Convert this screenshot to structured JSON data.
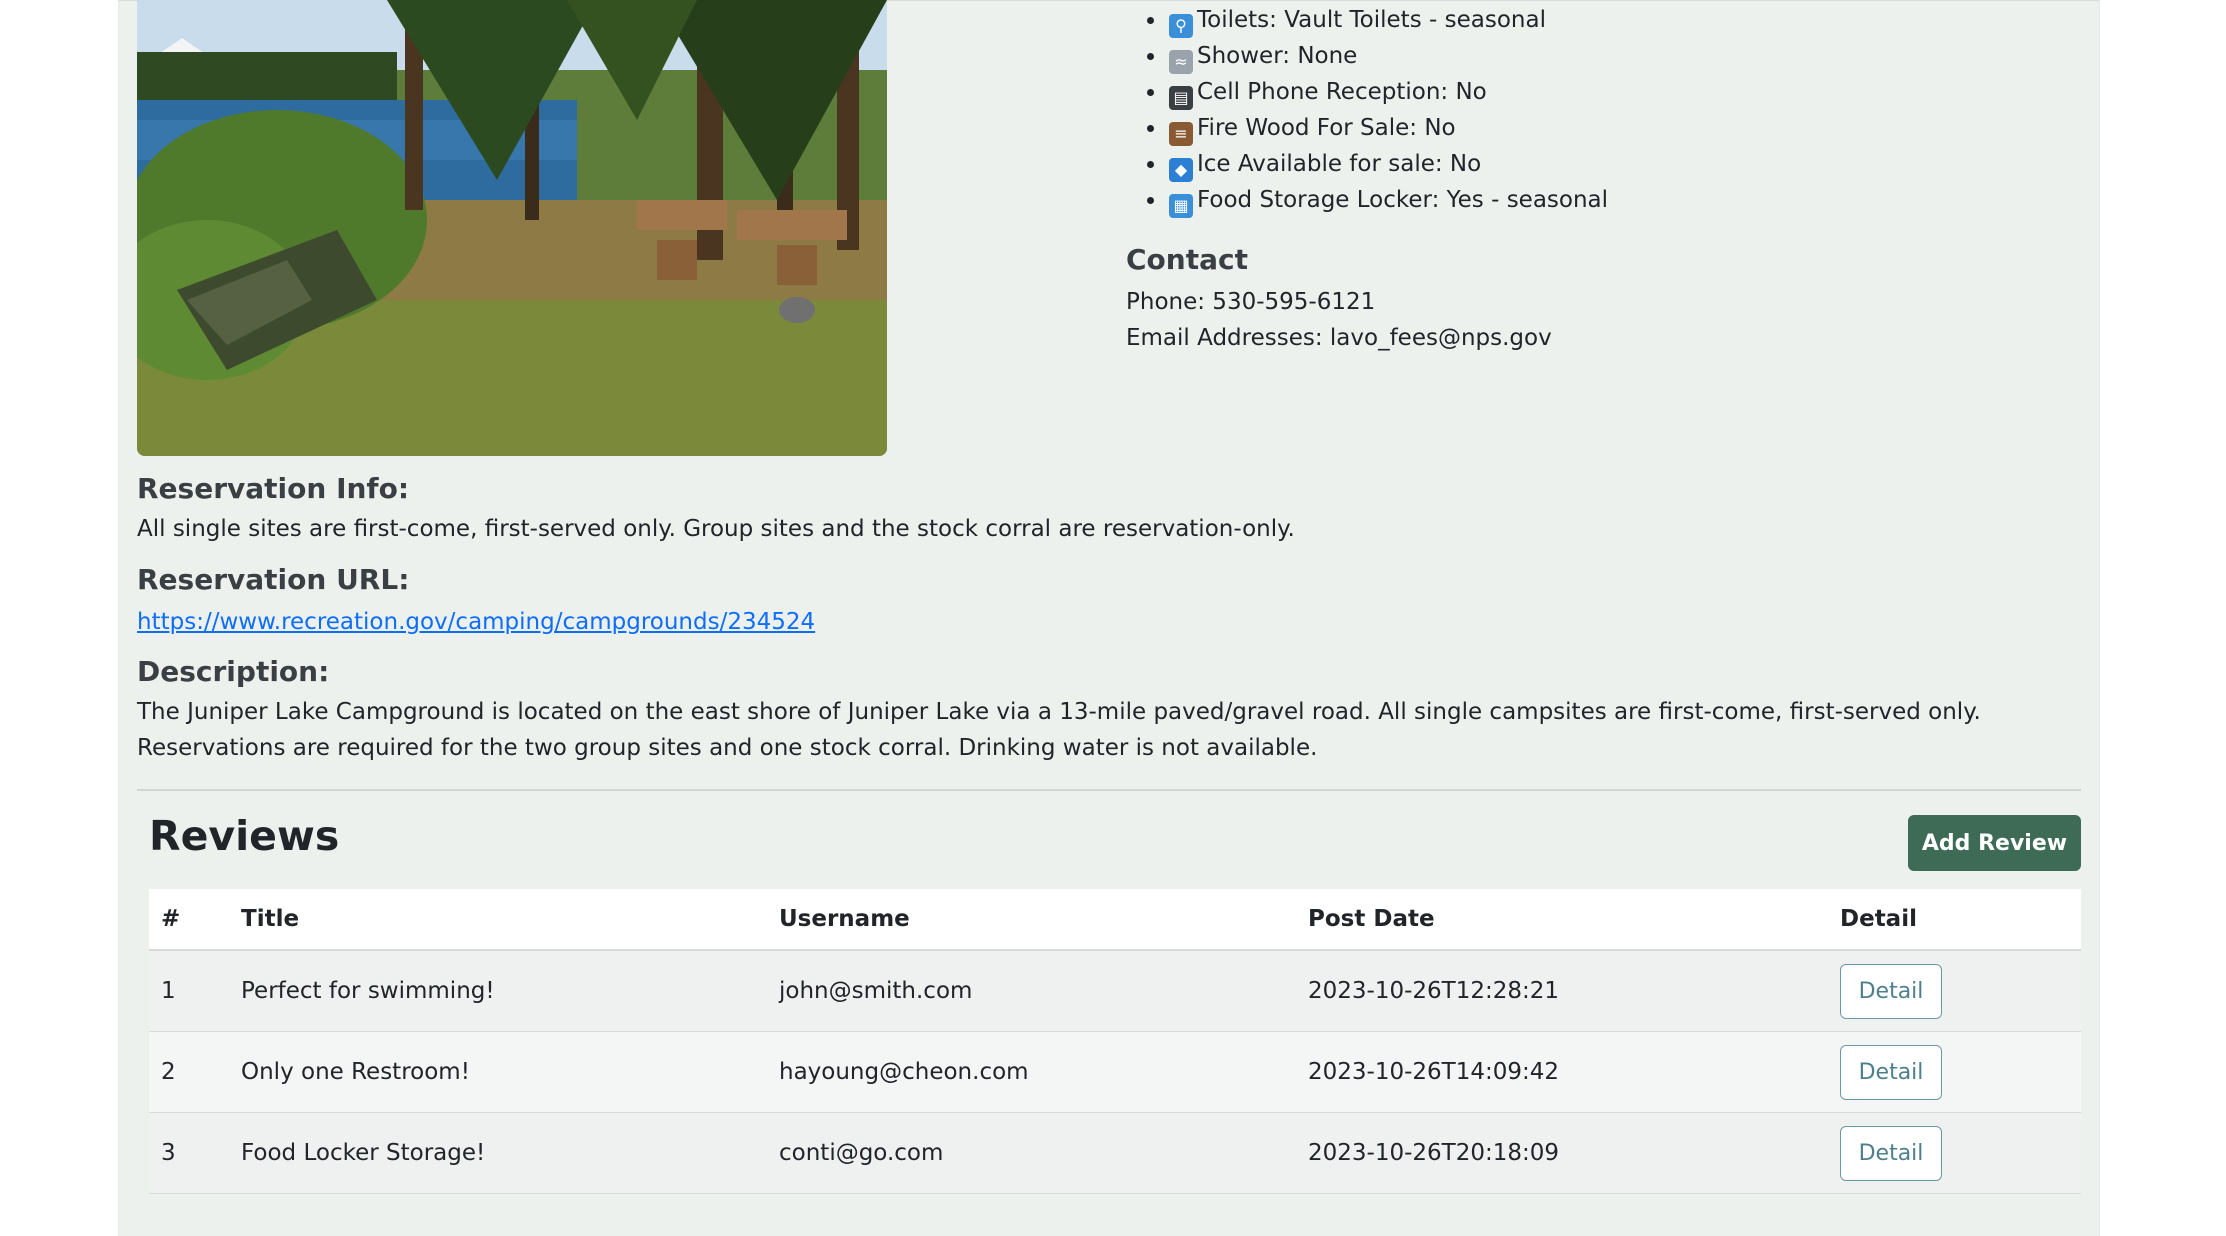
{
  "amenities": [
    {
      "icon": "restroom-icon",
      "icon_color": "#3a8fd8",
      "glyph": "⚲",
      "label": "Toilets: Vault Toilets - seasonal"
    },
    {
      "icon": "shower-icon",
      "icon_color": "#9aa3ab",
      "glyph": "≈",
      "label": "Shower: None"
    },
    {
      "icon": "phone-icon",
      "icon_color": "#3a3f44",
      "glyph": "▤",
      "label": "Cell Phone Reception: No"
    },
    {
      "icon": "firewood-icon",
      "icon_color": "#8a5a32",
      "glyph": "≡",
      "label": "Fire Wood For Sale: No"
    },
    {
      "icon": "ice-icon",
      "icon_color": "#2d7fd3",
      "glyph": "◆",
      "label": "Ice Available for sale: No"
    },
    {
      "icon": "locker-icon",
      "icon_color": "#3a8fd8",
      "glyph": "▦",
      "label": "Food Storage Locker: Yes - seasonal"
    }
  ],
  "contact": {
    "heading": "Contact",
    "phone": "Phone: 530-595-6121",
    "email": "Email Addresses: lavo_fees@nps.gov"
  },
  "reservation_info": {
    "heading": "Reservation Info:",
    "text": "All single sites are first-come, first-served only. Group sites and the stock corral are reservation-only."
  },
  "reservation_url": {
    "heading": "Reservation URL:",
    "link": "https://www.recreation.gov/camping/campgrounds/234524"
  },
  "description": {
    "heading": "Description:",
    "text": "The Juniper Lake Campground is located on the east shore of Juniper Lake via a 13-mile paved/gravel road. All single campsites are first-come, first-served only. Reservations are required for the two group sites and one stock corral. Drinking water is not available."
  },
  "reviews": {
    "title": "Reviews",
    "add_button": "Add Review",
    "columns": [
      "#",
      "Title",
      "Username",
      "Post Date",
      "Detail"
    ],
    "rows": [
      {
        "num": "1",
        "title": "Perfect for swimming!",
        "username": "john@smith.com",
        "date": "2023-10-26T12:28:21",
        "detail": "Detail"
      },
      {
        "num": "2",
        "title": "Only one Restroom!",
        "username": "hayoung@cheon.com",
        "date": "2023-10-26T14:09:42",
        "detail": "Detail"
      },
      {
        "num": "3",
        "title": "Food Locker Storage!",
        "username": "conti@go.com",
        "date": "2023-10-26T20:18:09",
        "detail": "Detail"
      }
    ]
  }
}
